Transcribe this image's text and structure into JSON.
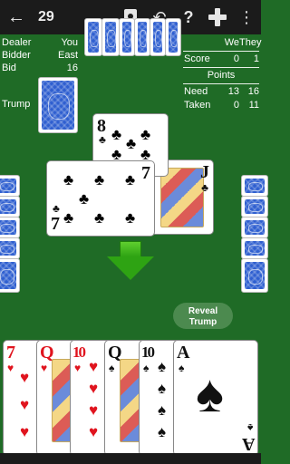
{
  "topbar": {
    "back_icon": "back-arrow-icon",
    "hand_number": "29",
    "icons": [
      "card-icon",
      "undo-icon",
      "help-icon",
      "gamepad-icon",
      "more-vert-icon"
    ],
    "help_glyph": "?",
    "undo_glyph": "↶",
    "more_glyph": "⋮",
    "back_glyph": "←"
  },
  "info": {
    "dealer_label": "Dealer",
    "dealer_value": "You",
    "bidder_label": "Bidder",
    "bidder_value": "East",
    "bid_label": "Bid",
    "bid_value": "16",
    "trump_label": "Trump"
  },
  "scores": {
    "we": "We",
    "they": "They",
    "score_label": "Score",
    "score_we": "0",
    "score_they": "1",
    "points_label": "Points",
    "need_label": "Need",
    "need_we": "13",
    "need_they": "16",
    "taken_label": "Taken",
    "taken_we": "0",
    "taken_they": "11"
  },
  "trick": {
    "north": {
      "rank": "8",
      "suit": "♣"
    },
    "west": {
      "rank": "7",
      "suit": "♣"
    },
    "east": {
      "rank": "J",
      "suit": "♣"
    }
  },
  "reveal_button": {
    "line1": "Reveal",
    "line2": "Trump"
  },
  "hand": [
    {
      "rank": "7",
      "suit": "♥"
    },
    {
      "rank": "Q",
      "suit": "♥"
    },
    {
      "rank": "10",
      "suit": "♥"
    },
    {
      "rank": "Q",
      "suit": "♠"
    },
    {
      "rank": "10",
      "suit": "♠"
    },
    {
      "rank": "A",
      "suit": "♠"
    }
  ],
  "colors": {
    "felt": "#1f6b26",
    "card_back": "#2f5fd0",
    "heart": "#e0141e",
    "arrow": "#2ea313"
  }
}
